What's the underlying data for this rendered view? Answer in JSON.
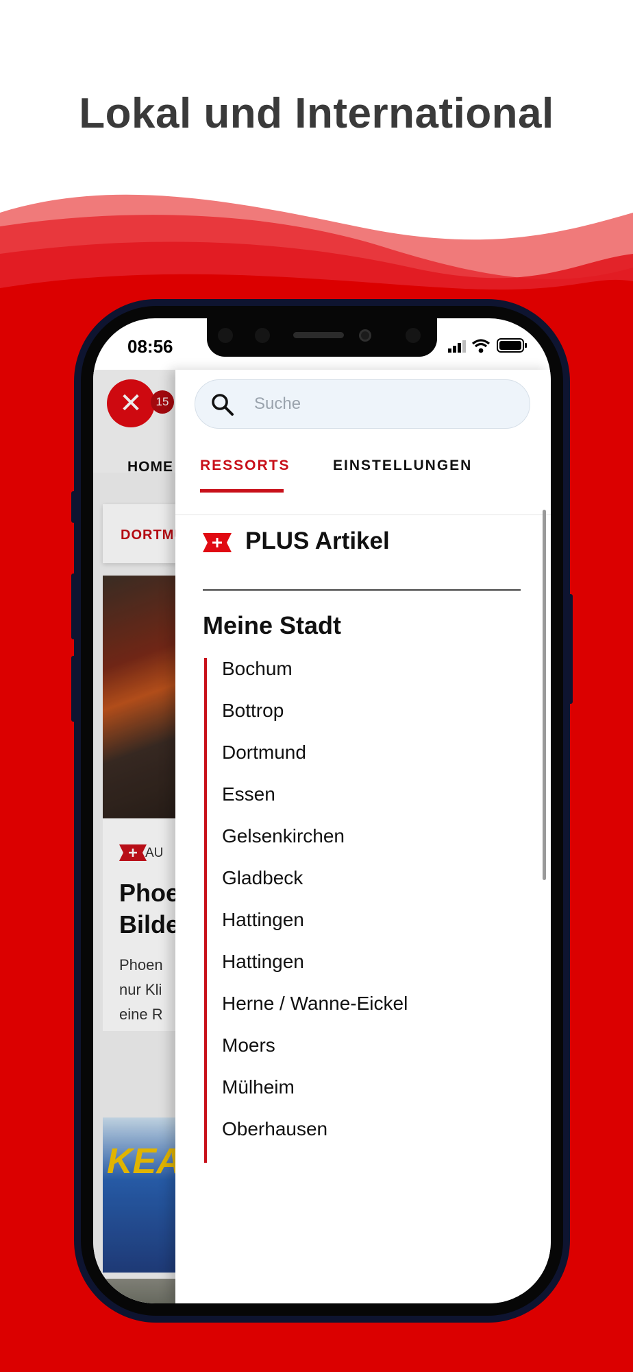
{
  "headline": "Lokal und International",
  "colors": {
    "brand_red": "#e00a12",
    "accent_red": "#c8101a",
    "wave_light": "#f08080"
  },
  "status_bar": {
    "time": "08:56",
    "icons": [
      "cellular-icon",
      "wifi-icon",
      "battery-icon"
    ]
  },
  "background_app": {
    "close_symbol": "✕",
    "notification_count": "15",
    "home_tab": "HOME",
    "city_chip": "DORTMUND",
    "article_kicker": "AU",
    "article_title": "Phoe\nBilde",
    "article_teaser": "Phoen\nnur Kli\neine R",
    "image2_text": "KEA"
  },
  "drawer": {
    "search": {
      "placeholder": "Suche",
      "value": ""
    },
    "tabs": [
      {
        "label": "RESSORTS",
        "active": true
      },
      {
        "label": "EINSTELLUNGEN",
        "active": false
      }
    ],
    "plus_item": {
      "label": "PLUS Artikel"
    },
    "section_title": "Meine Stadt",
    "cities": [
      "Bochum",
      "Bottrop",
      "Dortmund",
      "Essen",
      "Gelsenkirchen",
      "Gladbeck",
      "Hattingen",
      "Hattingen",
      "Herne / Wanne-Eickel",
      "Moers",
      "Mülheim",
      "Oberhausen"
    ]
  }
}
